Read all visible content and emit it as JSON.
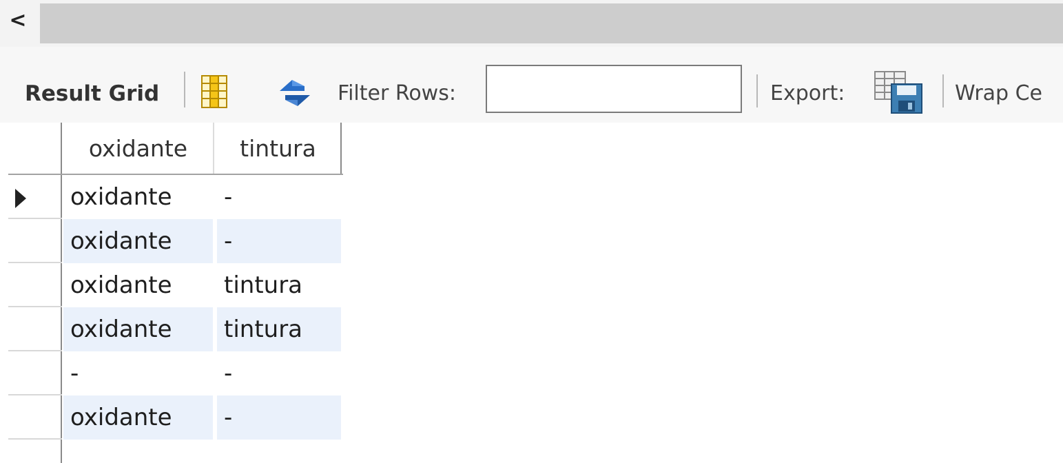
{
  "toolbar": {
    "result_grid_label": "Result Grid",
    "filter_label": "Filter Rows:",
    "filter_value": "",
    "export_label": "Export:",
    "wrap_label": "Wrap Ce",
    "icons": {
      "grid": "form-grid-icon",
      "refresh": "refresh-icon",
      "export": "export-save-icon"
    }
  },
  "scrollbar": {
    "left_arrow": "<"
  },
  "grid": {
    "columns": [
      "oxidante",
      "tintura"
    ],
    "rows": [
      [
        "oxidante",
        "-"
      ],
      [
        "oxidante",
        "-"
      ],
      [
        "oxidante",
        "tintura"
      ],
      [
        "oxidante",
        "tintura"
      ],
      [
        "-",
        "-"
      ],
      [
        "oxidante",
        "-"
      ]
    ],
    "selected_row": 0
  },
  "colors": {
    "alt_row": "#eaf1fb",
    "scroll_track": "#cdcdcd",
    "refresh_blue": "#2a6fc9",
    "grid_icon_yellow": "#f5c518"
  }
}
